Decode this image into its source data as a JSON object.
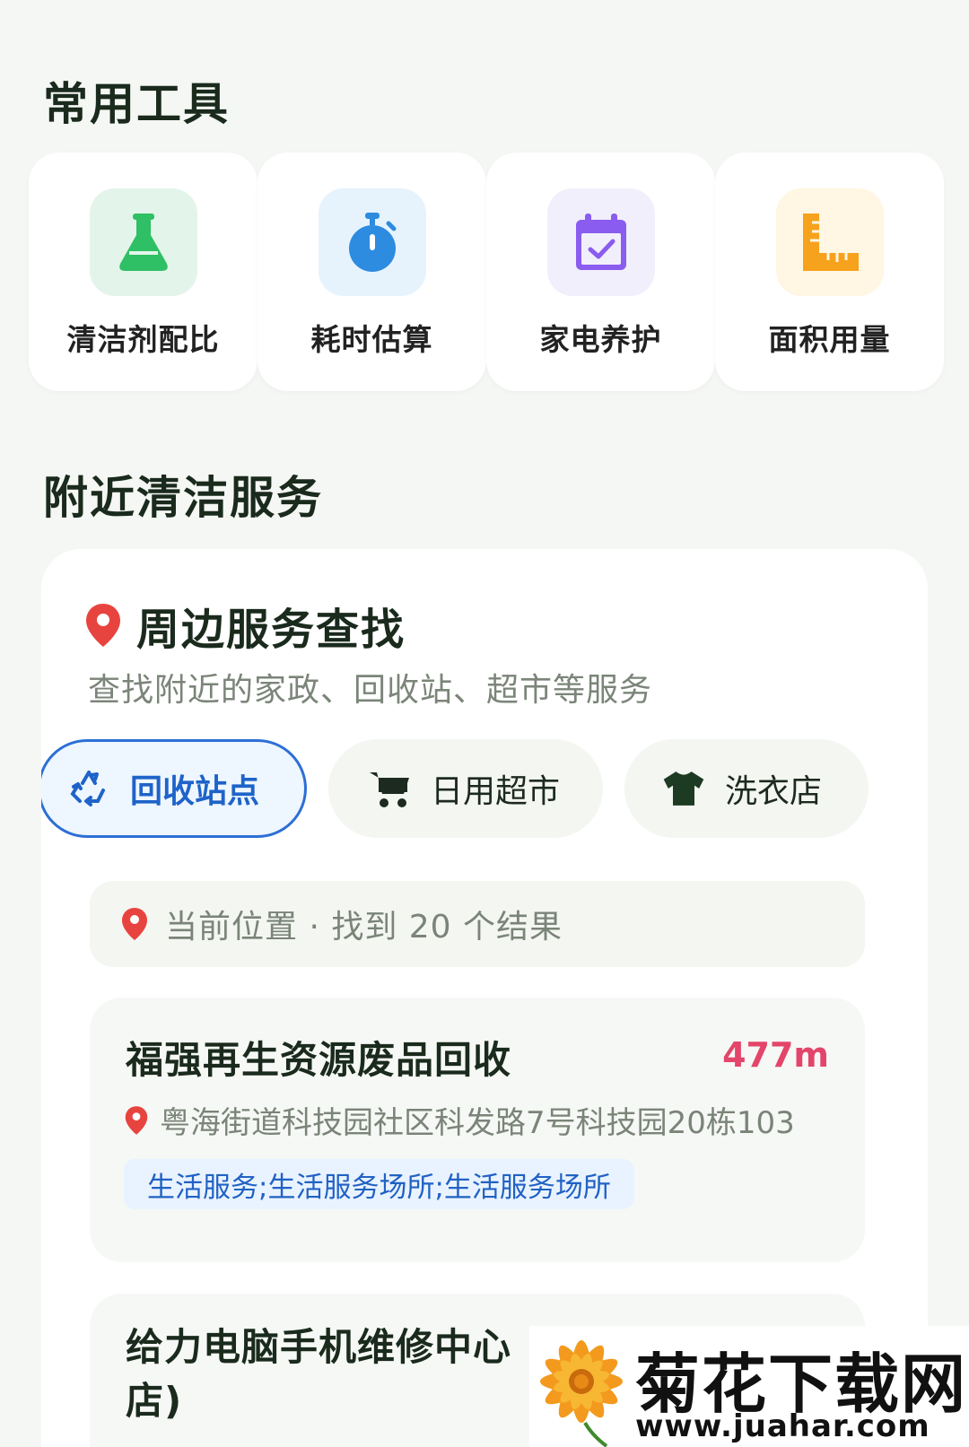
{
  "tools": {
    "title": "常用工具",
    "items": [
      {
        "label": "清洁剂配比",
        "icon": "flask-icon",
        "bg": "#e3f5ea",
        "color": "#2fbf64"
      },
      {
        "label": "耗时估算",
        "icon": "stopwatch-icon",
        "bg": "#e6f3fd",
        "color": "#2d8be0"
      },
      {
        "label": "家电养护",
        "icon": "calendar-check-icon",
        "bg": "#f2effc",
        "color": "#8a5cf0"
      },
      {
        "label": "面积用量",
        "icon": "ruler-icon",
        "bg": "#fff6e3",
        "color": "#f7a21c"
      }
    ]
  },
  "nearby": {
    "title": "附近清洁服务",
    "finder_title": "周边服务查找",
    "finder_subtitle": "查找附近的家政、回收站、超市等服务",
    "chips": [
      {
        "label": "回收站点",
        "icon": "recycle-icon",
        "active": true
      },
      {
        "label": "日用超市",
        "icon": "cart-icon",
        "active": false
      },
      {
        "label": "洗衣店",
        "icon": "shirt-icon",
        "active": false
      }
    ],
    "location_text": "当前位置 · 找到 20 个结果",
    "results": [
      {
        "name": "福强再生资源废品回收",
        "distance": "477m",
        "address": "粤海街道科技园社区科发路7号科技园20栋103",
        "tag": "生活服务;生活服务场所;生活服务场所"
      },
      {
        "name": "给力电脑手机维修中心",
        "name_line2": "店)"
      }
    ]
  },
  "watermark": {
    "text": "菊花下载网",
    "url": "www.juahar.com"
  },
  "colors": {
    "accent_blue": "#2d6fd6",
    "distance_red": "#e4456a",
    "pin_red": "#e8443f"
  }
}
